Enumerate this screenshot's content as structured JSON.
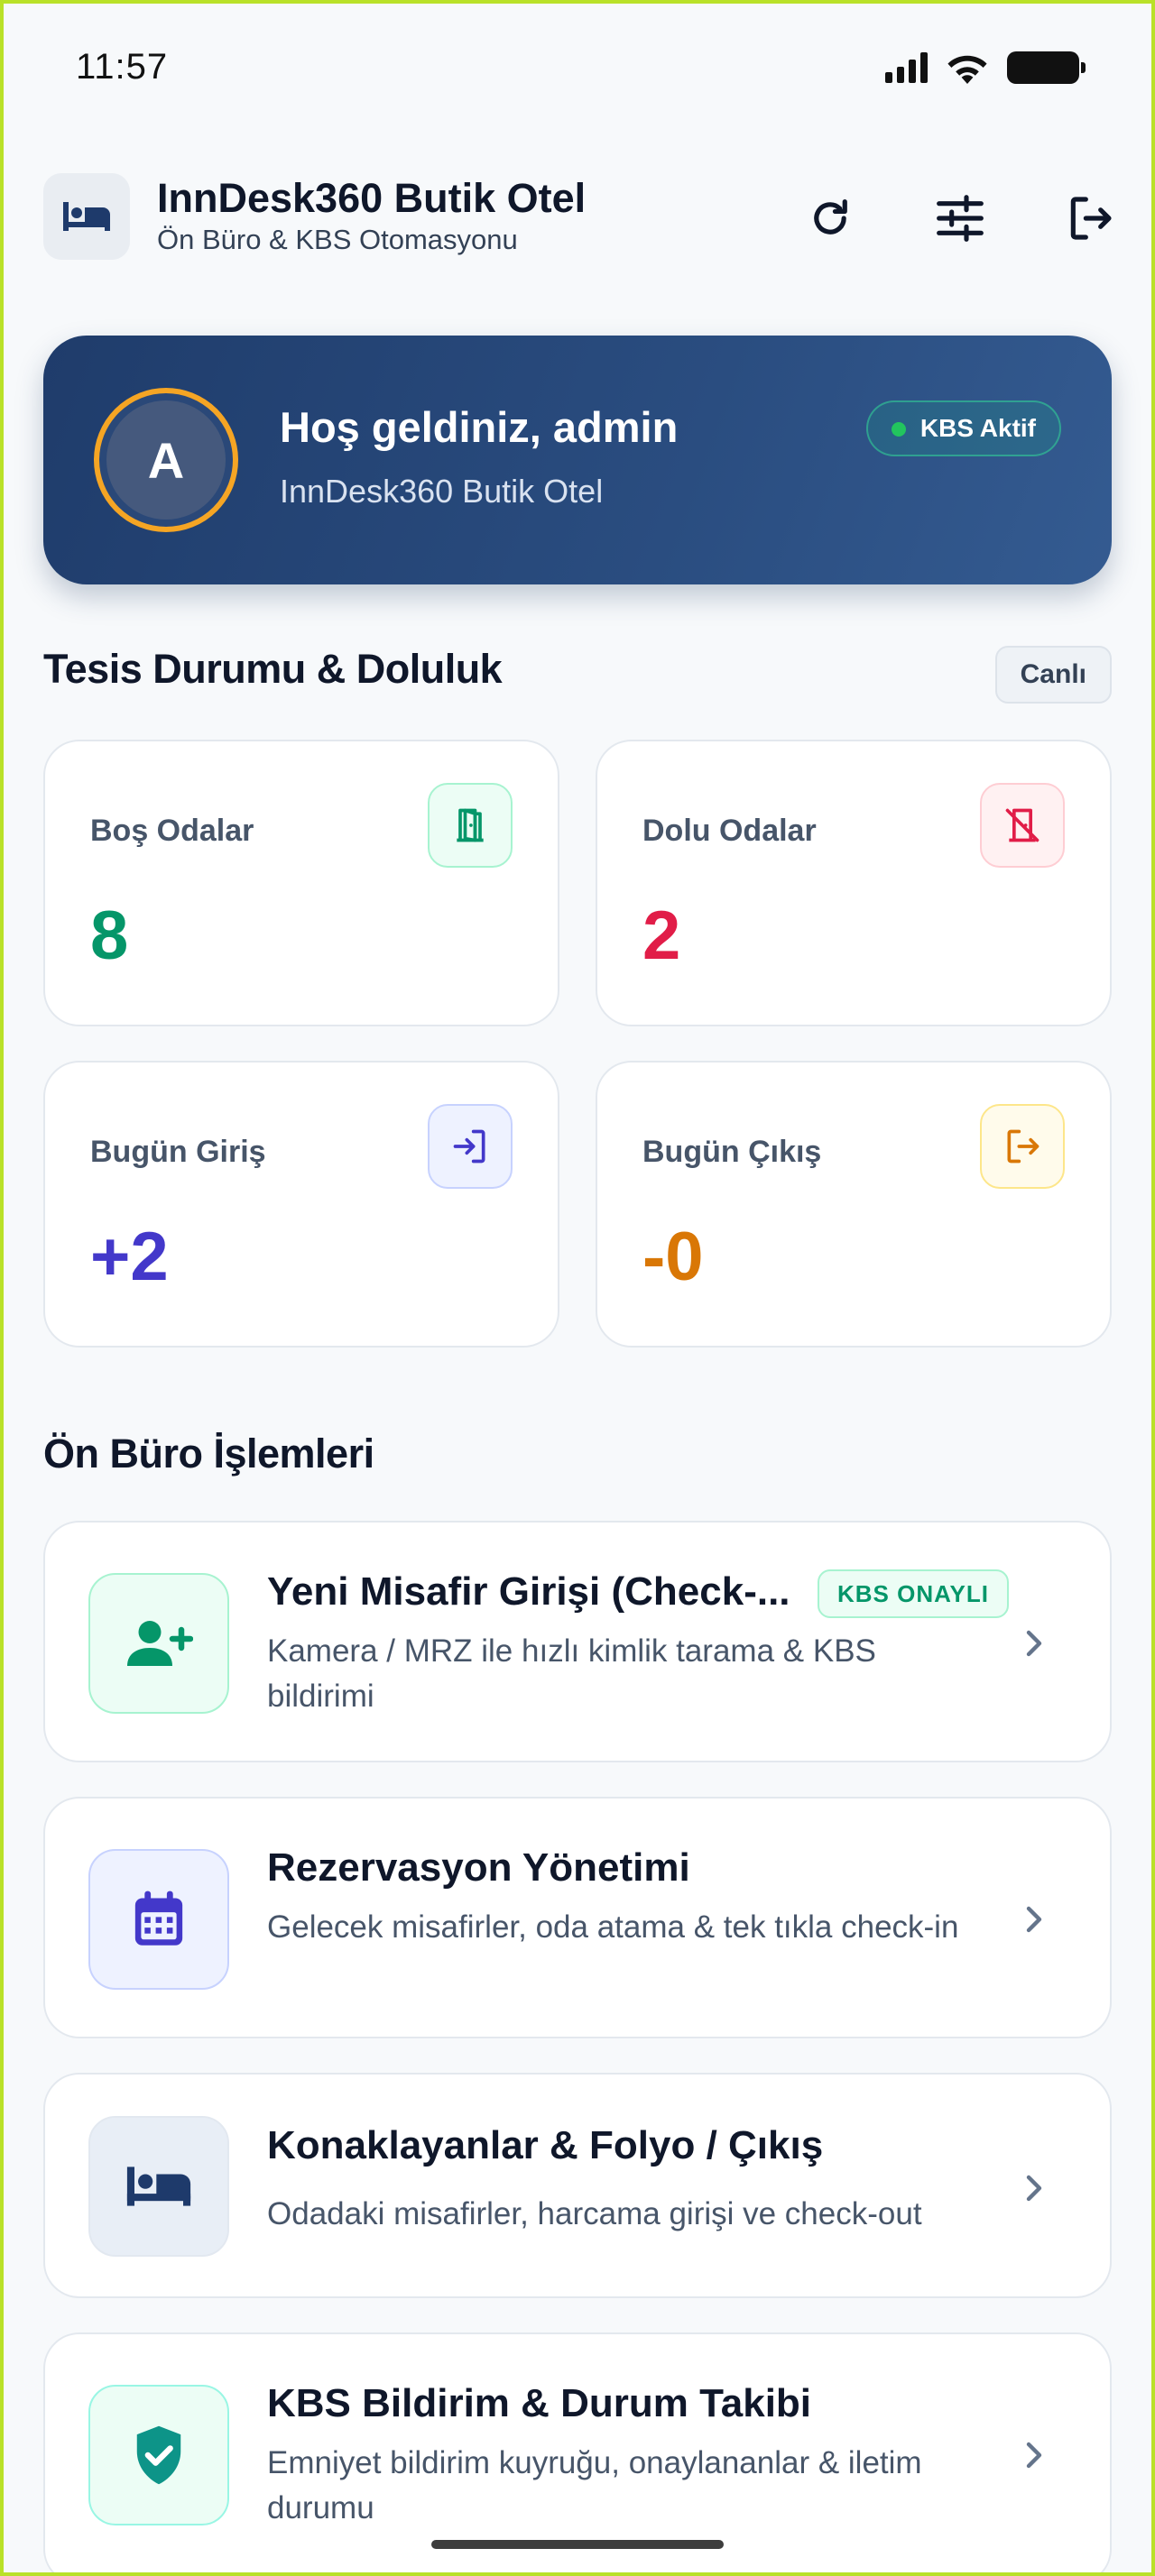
{
  "status_bar": {
    "time": "11:57"
  },
  "header": {
    "title": "InnDesk360 Butik Otel",
    "subtitle": "Ön Büro & KBS Otomasyonu",
    "icons": [
      "bed-icon",
      "refresh-icon",
      "sliders-icon",
      "logout-icon"
    ]
  },
  "welcome": {
    "avatar_letter": "A",
    "title": "Hoş geldiniz, admin",
    "subtitle": "InnDesk360 Butik Otel",
    "kbs_status": "KBS Aktif"
  },
  "facility": {
    "title": "Tesis Durumu & Doluluk",
    "live_label": "Canlı",
    "stats": [
      {
        "label": "Boş Odalar",
        "value": "8",
        "color": "#059669",
        "icon": "door-open-icon"
      },
      {
        "label": "Dolu Odalar",
        "value": "2",
        "color": "#e11d48",
        "icon": "door-closed-off-icon"
      },
      {
        "label": "Bugün Giriş",
        "value": "+2",
        "color": "#4338ca",
        "icon": "login-icon"
      },
      {
        "label": "Bugün Çıkış",
        "value": "-0",
        "color": "#d97706",
        "icon": "logout-icon"
      }
    ]
  },
  "front_office": {
    "title": "Ön Büro İşlemleri",
    "actions": [
      {
        "title": "Yeni Misafir Girişi (Check-...",
        "badge": "KBS ONAYLI",
        "desc": "Kamera / MRZ ile hızlı kimlik tarama & KBS bildirimi",
        "icon": "user-plus-icon"
      },
      {
        "title": "Rezervasyon Yönetimi",
        "desc": "Gelecek misafirler, oda atama & tek tıkla check-in",
        "icon": "calendar-icon"
      },
      {
        "title": "Konaklayanlar & Folyo / Çıkış",
        "desc": "Odadaki misafirler, harcama girişi ve check-out",
        "icon": "bed-icon"
      },
      {
        "title": "KBS Bildirim & Durum Takibi",
        "desc": "Emniyet bildirim kuyruğu, onaylananlar & iletim durumu",
        "icon": "shield-check-icon"
      }
    ]
  }
}
